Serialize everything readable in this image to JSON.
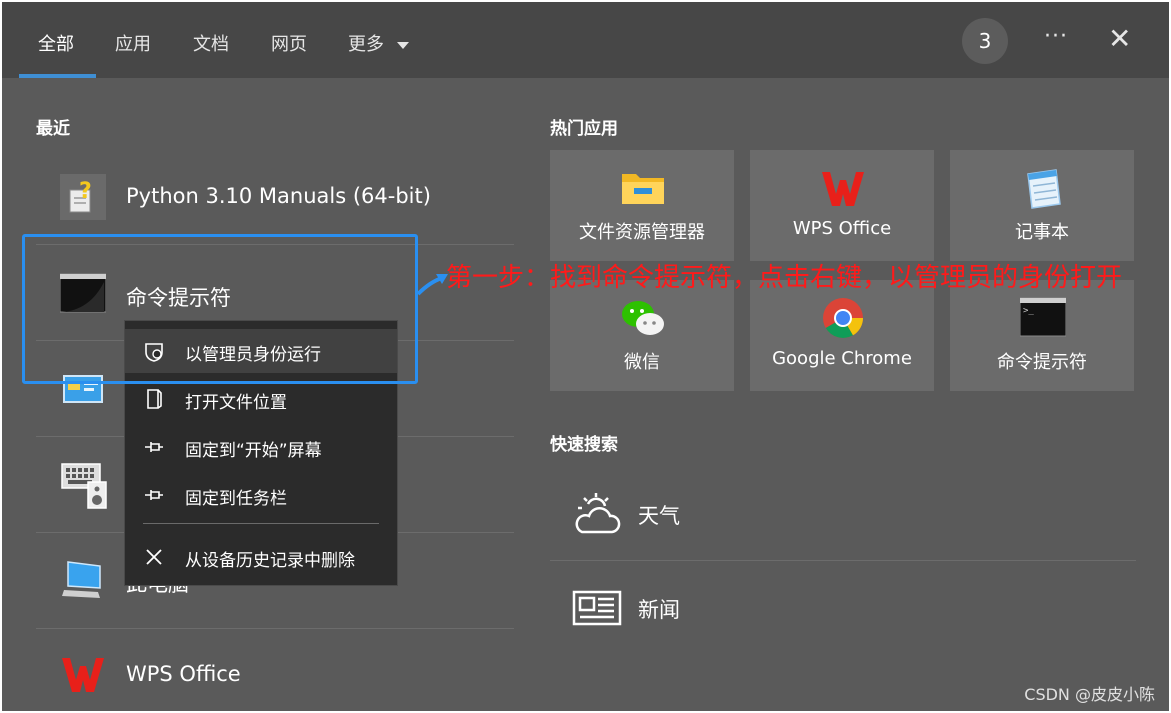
{
  "header": {
    "tabs": [
      {
        "label": "全部",
        "active": true
      },
      {
        "label": "应用"
      },
      {
        "label": "文档"
      },
      {
        "label": "网页"
      },
      {
        "label": "更多"
      }
    ],
    "more_dropdown_icon": "chevron-down-icon",
    "badge_count": "3",
    "menu_dots": "···",
    "close_symbol": "✕"
  },
  "recent": {
    "title": "最近",
    "items": [
      {
        "label": "Python 3.10 Manuals (64-bit)",
        "icon": "help-document-icon"
      },
      {
        "label": "命令提示符",
        "icon": "command-prompt-icon"
      },
      {
        "label": "",
        "icon": "control-panel-icon"
      },
      {
        "label": "",
        "icon": "keyboard-speaker-icon"
      },
      {
        "label": "此电脑",
        "icon": "computer-icon"
      },
      {
        "label": "WPS Office",
        "icon": "wps-icon"
      }
    ]
  },
  "context_menu": {
    "items": [
      {
        "label": "以管理员身份运行",
        "icon": "shield-icon",
        "highlighted": true
      },
      {
        "label": "打开文件位置",
        "icon": "folder-open-icon"
      },
      {
        "label": "固定到“开始”屏幕",
        "icon": "pin-icon"
      },
      {
        "label": "固定到任务栏",
        "icon": "pin-icon"
      },
      {
        "label": "从设备历史记录中删除",
        "icon": "close-icon"
      }
    ]
  },
  "top_apps": {
    "title": "热门应用",
    "tiles": [
      {
        "label": "文件资源管理器",
        "icon": "folder-icon"
      },
      {
        "label": "WPS Office",
        "icon": "wps-icon"
      },
      {
        "label": "记事本",
        "icon": "notepad-icon"
      },
      {
        "label": "微信",
        "icon": "wechat-icon"
      },
      {
        "label": "Google Chrome",
        "icon": "chrome-icon"
      },
      {
        "label": "命令提示符",
        "icon": "command-prompt-icon"
      }
    ]
  },
  "quick_search": {
    "title": "快速搜索",
    "items": [
      {
        "label": "天气",
        "icon": "weather-icon"
      },
      {
        "label": "新闻",
        "icon": "news-icon"
      }
    ]
  },
  "annotation": {
    "text": "第一步：找到命令提示符，点击右键，以管理员的身份打开",
    "color": "#ff1a1a",
    "highlight_color": "#2a8ff0"
  },
  "watermark": "CSDN @皮皮小陈",
  "colors": {
    "window_bg": "#5a5a5a",
    "header_bg": "#474747",
    "tile_bg": "#6b6b6b",
    "menu_bg": "#2b2b2b",
    "accent": "#3f8fd4"
  }
}
